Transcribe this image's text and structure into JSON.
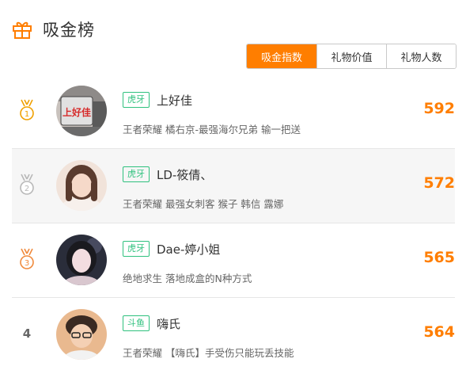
{
  "header": {
    "title": "吸金榜",
    "icon": "gift-icon"
  },
  "tabs": [
    {
      "label": "吸金指数",
      "active": true
    },
    {
      "label": "礼物价值",
      "active": false
    },
    {
      "label": "礼物人数",
      "active": false
    }
  ],
  "rows": [
    {
      "rank": "1",
      "platform": "虎牙",
      "name": "上好佳",
      "desc": "王者荣耀 橘右京-最强海尔兄弟 输一把送",
      "score": "592",
      "avatar_text": "上好佳"
    },
    {
      "rank": "2",
      "platform": "虎牙",
      "name": "LD-筱倩、",
      "desc": "王者荣耀 最强女刺客 猴子 韩信 露娜",
      "score": "572"
    },
    {
      "rank": "3",
      "platform": "虎牙",
      "name": "Dae-婷小姐",
      "desc": "绝地求生 落地成盒的N种方式",
      "score": "565"
    },
    {
      "rank": "4",
      "platform": "斗鱼",
      "name": "嗨氏",
      "desc": "王者荣耀 【嗨氏】手受伤只能玩丢技能",
      "score": "564"
    }
  ],
  "colors": {
    "accent": "#ff7e00",
    "badge": "#2fc17e",
    "gold": "#f0a000",
    "silver": "#b8b8b8",
    "bronze": "#f08a3c"
  }
}
